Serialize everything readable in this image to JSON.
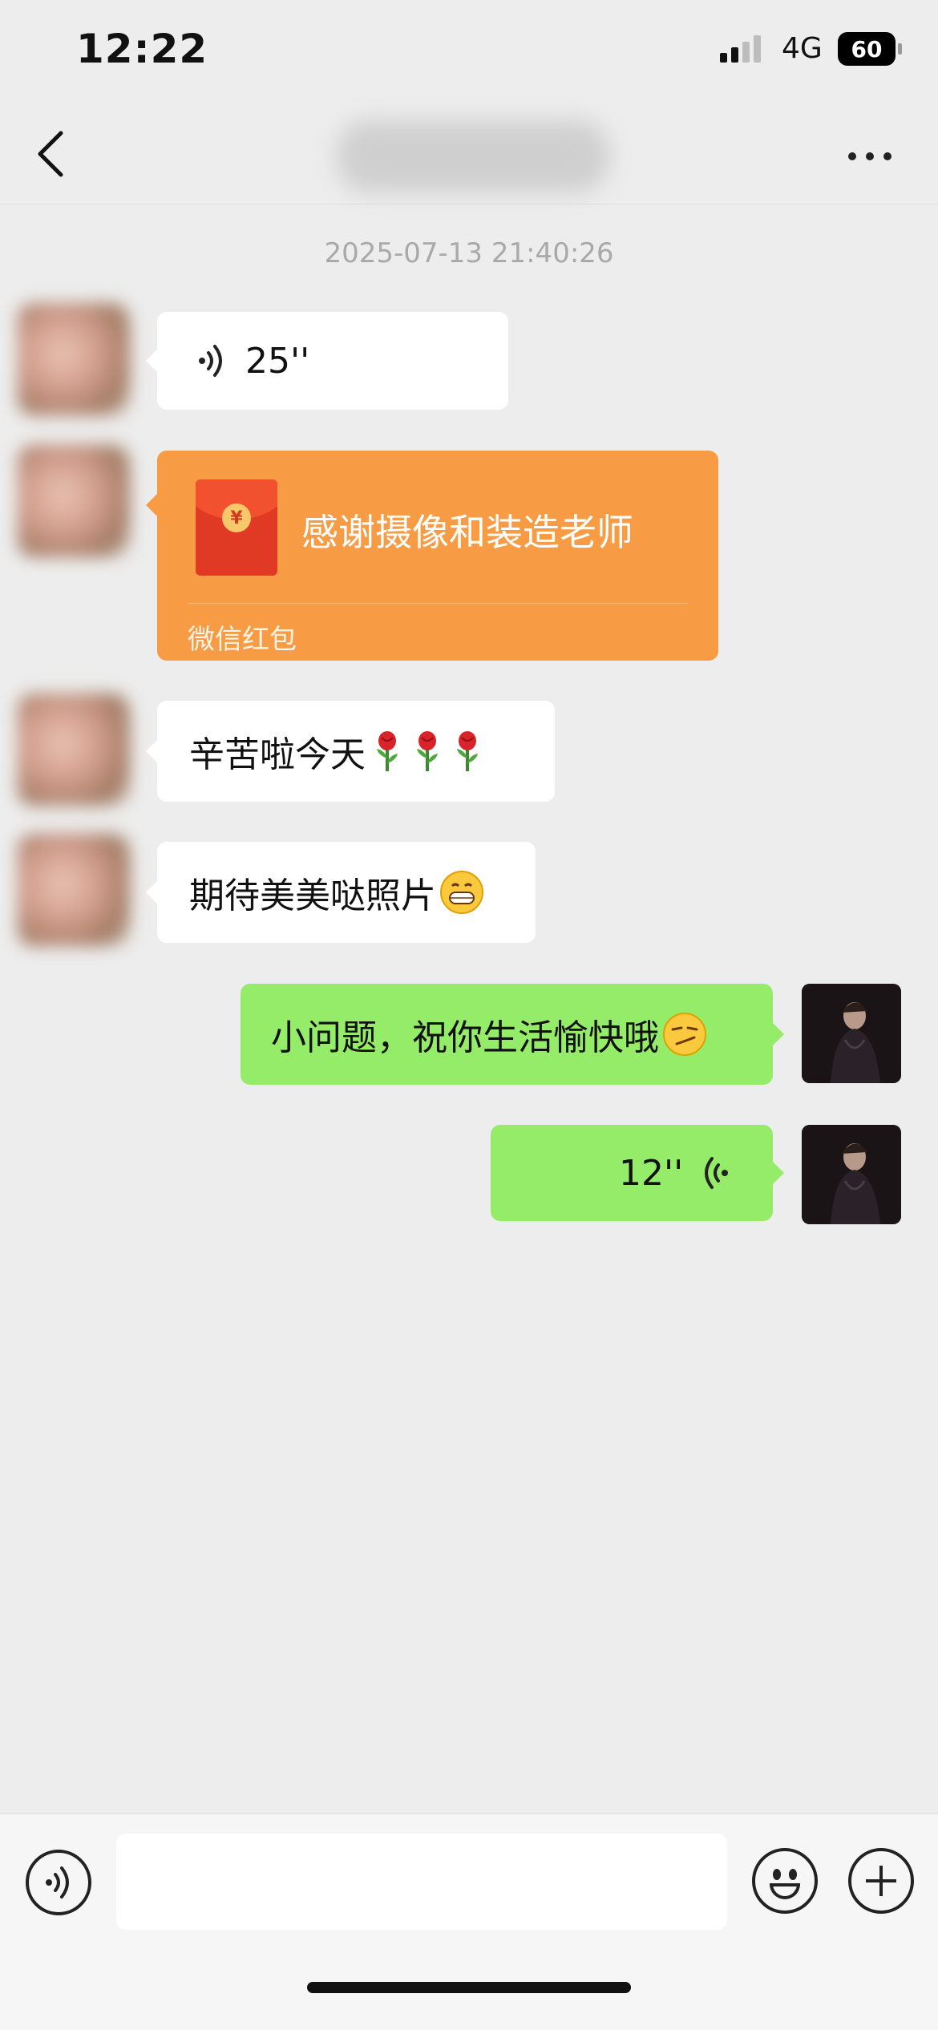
{
  "status_bar": {
    "time": "12:22",
    "network": "4G",
    "battery": "60"
  },
  "nav": {
    "back_icon": "chevron-left-icon",
    "more_icon": "ellipsis-icon"
  },
  "chat": {
    "timestamp": "2025-07-13 21:40:26",
    "messages": [
      {
        "type": "voice",
        "side": "in",
        "duration": "25''"
      },
      {
        "type": "red_packet",
        "side": "in",
        "title": "感谢摄像和装造老师",
        "label": "微信红包"
      },
      {
        "type": "text",
        "side": "in",
        "text": "辛苦啦今天",
        "emoji": [
          "rose",
          "rose",
          "rose"
        ]
      },
      {
        "type": "text",
        "side": "in",
        "text": "期待美美哒照片",
        "emoji": [
          "grin"
        ]
      },
      {
        "type": "text",
        "side": "out",
        "text": "小问题，祝你生活愉快哦",
        "emoji": [
          "smirk"
        ]
      },
      {
        "type": "voice",
        "side": "out",
        "duration": "12''"
      }
    ]
  },
  "input_bar": {
    "voice_icon": "voice-toggle-icon",
    "emoji_icon": "emoji-icon",
    "plus_icon": "plus-icon"
  },
  "colors": {
    "background": "#ededed",
    "outgoing_bubble": "#95ec69",
    "incoming_bubble": "#ffffff",
    "red_packet": "#f79c44"
  }
}
